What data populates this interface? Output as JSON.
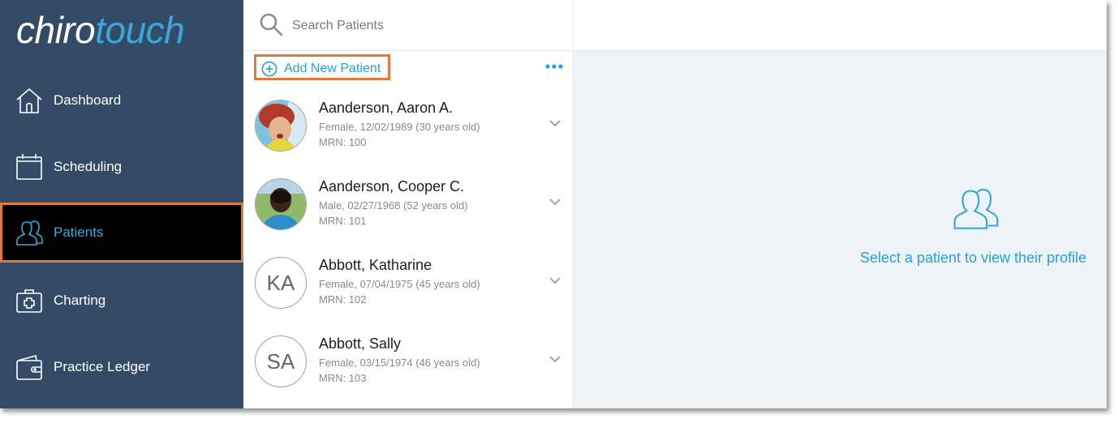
{
  "brand": {
    "part1": "chiro",
    "part2": "touch"
  },
  "colors": {
    "sidebar_bg": "#344b67",
    "accent": "#3aa7d9",
    "highlight": "#e07a3c",
    "active_bg": "#000000",
    "detail_bg": "#eef3f7"
  },
  "sidebar": {
    "items": [
      {
        "label": "Dashboard",
        "icon": "house-icon",
        "active": false
      },
      {
        "label": "Scheduling",
        "icon": "calendar-icon",
        "active": false
      },
      {
        "label": "Patients",
        "icon": "users-icon",
        "active": true
      },
      {
        "label": "Charting",
        "icon": "medical-kit-icon",
        "active": false
      },
      {
        "label": "Practice Ledger",
        "icon": "wallet-icon",
        "active": false
      }
    ]
  },
  "search": {
    "placeholder": "Search Patients",
    "value": ""
  },
  "list": {
    "add_label": "Add New Patient",
    "more_icon": "more-dots-icon",
    "patients": [
      {
        "name": "Aanderson, Aaron A.",
        "info": "Female, 12/02/1989 (30 years old)",
        "mrn": "MRN: 100",
        "avatar": "photo"
      },
      {
        "name": "Aanderson, Cooper C.",
        "info": "Male, 02/27/1968 (52 years old)",
        "mrn": "MRN: 101",
        "avatar": "photo"
      },
      {
        "name": "Abbott, Katharine",
        "info": "Female, 07/04/1975 (45 years old)",
        "mrn": "MRN: 102",
        "initials": "KA"
      },
      {
        "name": "Abbott, Sally",
        "info": "Female, 03/15/1974 (46 years old)",
        "mrn": "MRN: 103",
        "initials": "SA"
      }
    ]
  },
  "detail": {
    "icon": "users-icon",
    "message": "Select a patient to view their profile"
  }
}
